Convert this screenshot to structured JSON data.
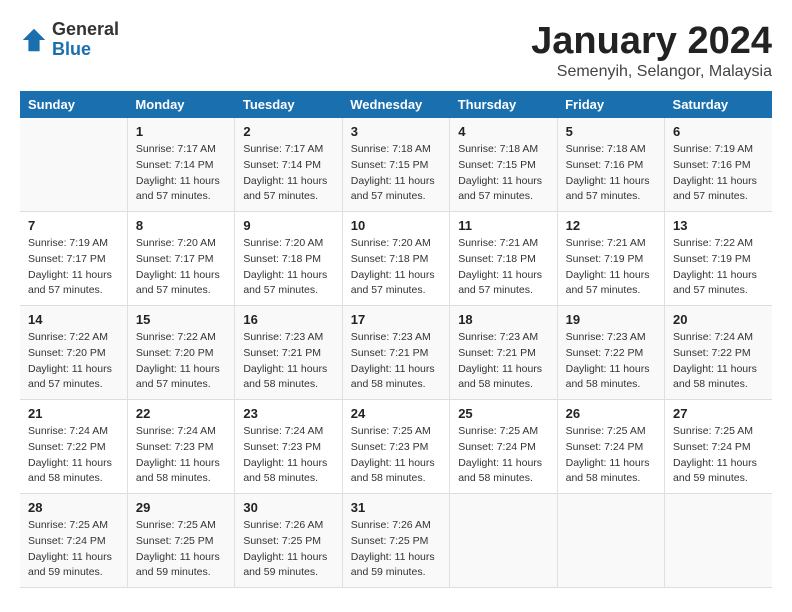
{
  "logo": {
    "general": "General",
    "blue": "Blue"
  },
  "title": "January 2024",
  "subtitle": "Semenyih, Selangor, Malaysia",
  "weekdays": [
    "Sunday",
    "Monday",
    "Tuesday",
    "Wednesday",
    "Thursday",
    "Friday",
    "Saturday"
  ],
  "weeks": [
    [
      {
        "num": "",
        "info": ""
      },
      {
        "num": "1",
        "info": "Sunrise: 7:17 AM\nSunset: 7:14 PM\nDaylight: 11 hours\nand 57 minutes."
      },
      {
        "num": "2",
        "info": "Sunrise: 7:17 AM\nSunset: 7:14 PM\nDaylight: 11 hours\nand 57 minutes."
      },
      {
        "num": "3",
        "info": "Sunrise: 7:18 AM\nSunset: 7:15 PM\nDaylight: 11 hours\nand 57 minutes."
      },
      {
        "num": "4",
        "info": "Sunrise: 7:18 AM\nSunset: 7:15 PM\nDaylight: 11 hours\nand 57 minutes."
      },
      {
        "num": "5",
        "info": "Sunrise: 7:18 AM\nSunset: 7:16 PM\nDaylight: 11 hours\nand 57 minutes."
      },
      {
        "num": "6",
        "info": "Sunrise: 7:19 AM\nSunset: 7:16 PM\nDaylight: 11 hours\nand 57 minutes."
      }
    ],
    [
      {
        "num": "7",
        "info": "Sunrise: 7:19 AM\nSunset: 7:17 PM\nDaylight: 11 hours\nand 57 minutes."
      },
      {
        "num": "8",
        "info": "Sunrise: 7:20 AM\nSunset: 7:17 PM\nDaylight: 11 hours\nand 57 minutes."
      },
      {
        "num": "9",
        "info": "Sunrise: 7:20 AM\nSunset: 7:18 PM\nDaylight: 11 hours\nand 57 minutes."
      },
      {
        "num": "10",
        "info": "Sunrise: 7:20 AM\nSunset: 7:18 PM\nDaylight: 11 hours\nand 57 minutes."
      },
      {
        "num": "11",
        "info": "Sunrise: 7:21 AM\nSunset: 7:18 PM\nDaylight: 11 hours\nand 57 minutes."
      },
      {
        "num": "12",
        "info": "Sunrise: 7:21 AM\nSunset: 7:19 PM\nDaylight: 11 hours\nand 57 minutes."
      },
      {
        "num": "13",
        "info": "Sunrise: 7:22 AM\nSunset: 7:19 PM\nDaylight: 11 hours\nand 57 minutes."
      }
    ],
    [
      {
        "num": "14",
        "info": "Sunrise: 7:22 AM\nSunset: 7:20 PM\nDaylight: 11 hours\nand 57 minutes."
      },
      {
        "num": "15",
        "info": "Sunrise: 7:22 AM\nSunset: 7:20 PM\nDaylight: 11 hours\nand 57 minutes."
      },
      {
        "num": "16",
        "info": "Sunrise: 7:23 AM\nSunset: 7:21 PM\nDaylight: 11 hours\nand 58 minutes."
      },
      {
        "num": "17",
        "info": "Sunrise: 7:23 AM\nSunset: 7:21 PM\nDaylight: 11 hours\nand 58 minutes."
      },
      {
        "num": "18",
        "info": "Sunrise: 7:23 AM\nSunset: 7:21 PM\nDaylight: 11 hours\nand 58 minutes."
      },
      {
        "num": "19",
        "info": "Sunrise: 7:23 AM\nSunset: 7:22 PM\nDaylight: 11 hours\nand 58 minutes."
      },
      {
        "num": "20",
        "info": "Sunrise: 7:24 AM\nSunset: 7:22 PM\nDaylight: 11 hours\nand 58 minutes."
      }
    ],
    [
      {
        "num": "21",
        "info": "Sunrise: 7:24 AM\nSunset: 7:22 PM\nDaylight: 11 hours\nand 58 minutes."
      },
      {
        "num": "22",
        "info": "Sunrise: 7:24 AM\nSunset: 7:23 PM\nDaylight: 11 hours\nand 58 minutes."
      },
      {
        "num": "23",
        "info": "Sunrise: 7:24 AM\nSunset: 7:23 PM\nDaylight: 11 hours\nand 58 minutes."
      },
      {
        "num": "24",
        "info": "Sunrise: 7:25 AM\nSunset: 7:23 PM\nDaylight: 11 hours\nand 58 minutes."
      },
      {
        "num": "25",
        "info": "Sunrise: 7:25 AM\nSunset: 7:24 PM\nDaylight: 11 hours\nand 58 minutes."
      },
      {
        "num": "26",
        "info": "Sunrise: 7:25 AM\nSunset: 7:24 PM\nDaylight: 11 hours\nand 58 minutes."
      },
      {
        "num": "27",
        "info": "Sunrise: 7:25 AM\nSunset: 7:24 PM\nDaylight: 11 hours\nand 59 minutes."
      }
    ],
    [
      {
        "num": "28",
        "info": "Sunrise: 7:25 AM\nSunset: 7:24 PM\nDaylight: 11 hours\nand 59 minutes."
      },
      {
        "num": "29",
        "info": "Sunrise: 7:25 AM\nSunset: 7:25 PM\nDaylight: 11 hours\nand 59 minutes."
      },
      {
        "num": "30",
        "info": "Sunrise: 7:26 AM\nSunset: 7:25 PM\nDaylight: 11 hours\nand 59 minutes."
      },
      {
        "num": "31",
        "info": "Sunrise: 7:26 AM\nSunset: 7:25 PM\nDaylight: 11 hours\nand 59 minutes."
      },
      {
        "num": "",
        "info": ""
      },
      {
        "num": "",
        "info": ""
      },
      {
        "num": "",
        "info": ""
      }
    ]
  ]
}
